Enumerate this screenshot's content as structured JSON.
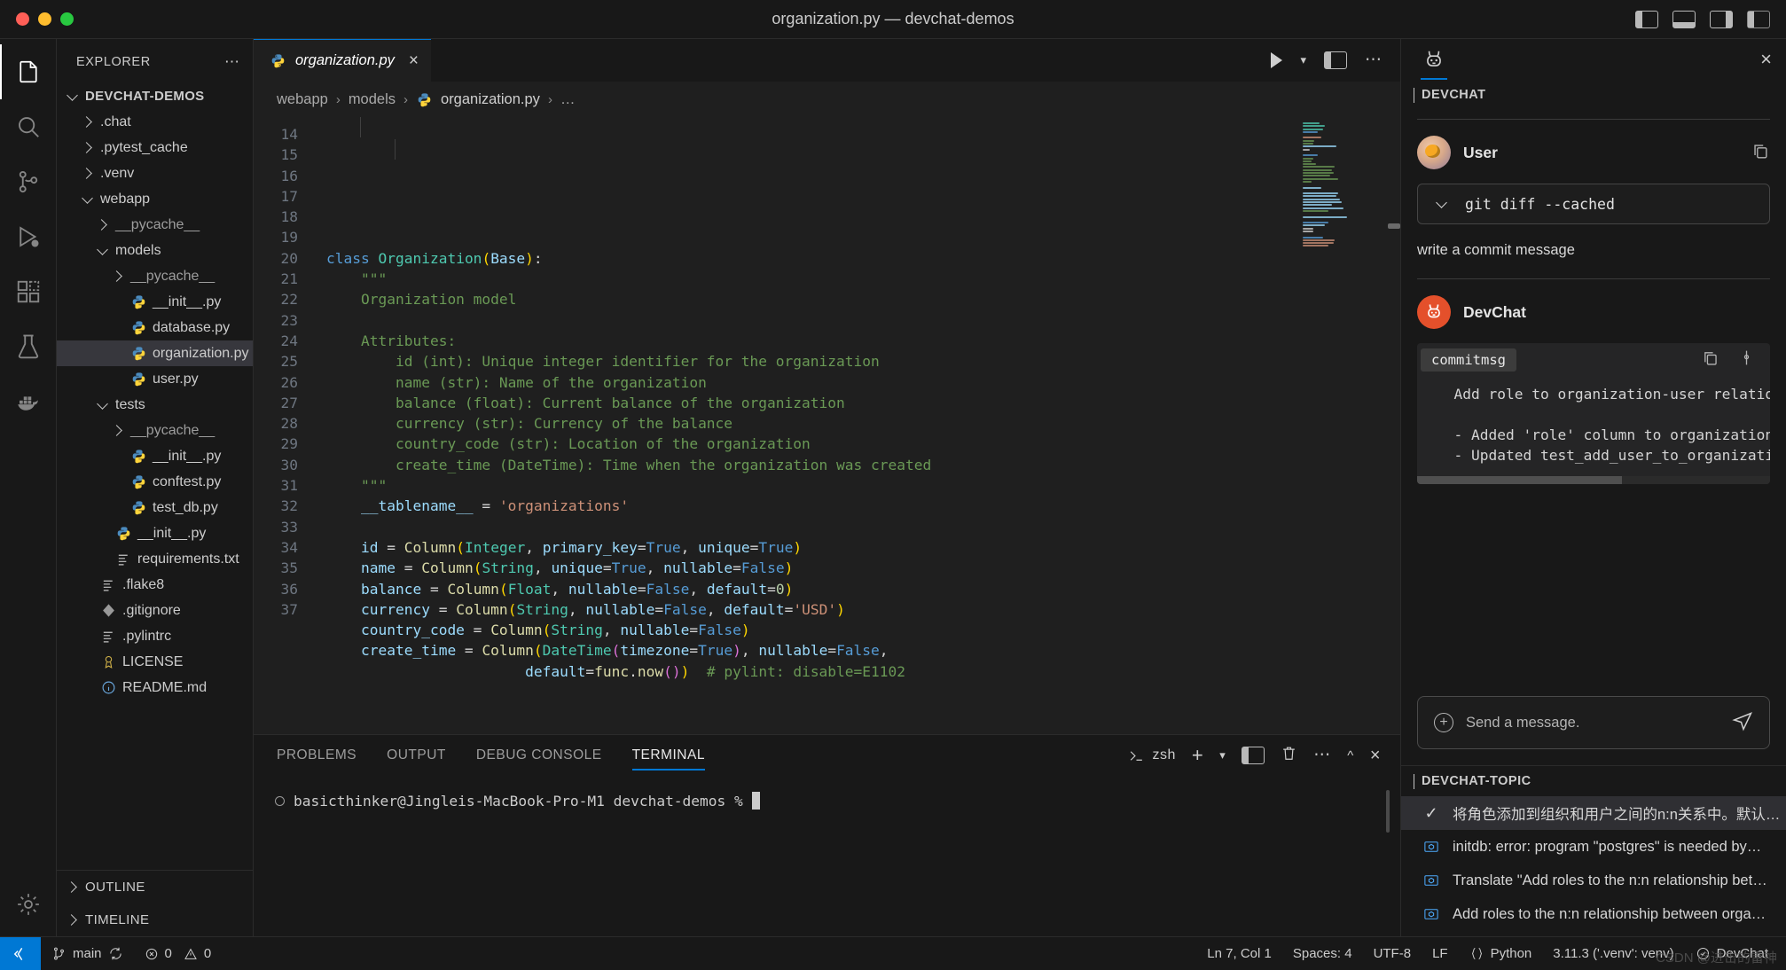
{
  "window": {
    "title": "organization.py — devchat-demos",
    "traffic_lights": [
      "close",
      "minimize",
      "zoom"
    ],
    "right_icons": [
      "panel-left-icon",
      "panel-bottom-icon",
      "panel-right-icon",
      "layout-icon",
      "more-icon"
    ]
  },
  "activitybar": {
    "items": [
      {
        "name": "explorer",
        "icon": "files-icon",
        "active": true
      },
      {
        "name": "search",
        "icon": "search-icon",
        "active": false
      },
      {
        "name": "source-control",
        "icon": "source-control-icon",
        "active": false
      },
      {
        "name": "run-and-debug",
        "icon": "debug-icon",
        "active": false
      },
      {
        "name": "extensions",
        "icon": "extensions-icon",
        "active": false
      },
      {
        "name": "testing",
        "icon": "beaker-icon",
        "active": false
      },
      {
        "name": "docker",
        "icon": "docker-icon",
        "active": false
      }
    ],
    "bottom": [
      {
        "name": "manage",
        "icon": "gear-icon"
      }
    ]
  },
  "explorer": {
    "title": "EXPLORER",
    "more_label": "...",
    "tree": [
      {
        "label": "DEVCHAT-DEMOS",
        "depth": 0,
        "type": "root",
        "twisty": "down"
      },
      {
        "label": ".chat",
        "depth": 1,
        "type": "folder",
        "twisty": "right"
      },
      {
        "label": ".pytest_cache",
        "depth": 1,
        "type": "folder",
        "twisty": "right"
      },
      {
        "label": ".venv",
        "depth": 1,
        "type": "folder",
        "twisty": "right"
      },
      {
        "label": "webapp",
        "depth": 1,
        "type": "folder",
        "twisty": "down"
      },
      {
        "label": "__pycache__",
        "depth": 2,
        "type": "folder",
        "twisty": "right",
        "dim": true
      },
      {
        "label": "models",
        "depth": 2,
        "type": "folder",
        "twisty": "down"
      },
      {
        "label": "__pycache__",
        "depth": 3,
        "type": "folder",
        "twisty": "right",
        "dim": true
      },
      {
        "label": "__init__.py",
        "depth": 3,
        "type": "python"
      },
      {
        "label": "database.py",
        "depth": 3,
        "type": "python"
      },
      {
        "label": "organization.py",
        "depth": 3,
        "type": "python",
        "selected": true
      },
      {
        "label": "user.py",
        "depth": 3,
        "type": "python"
      },
      {
        "label": "tests",
        "depth": 2,
        "type": "folder",
        "twisty": "down"
      },
      {
        "label": "__pycache__",
        "depth": 3,
        "type": "folder",
        "twisty": "right",
        "dim": true
      },
      {
        "label": "__init__.py",
        "depth": 3,
        "type": "python"
      },
      {
        "label": "conftest.py",
        "depth": 3,
        "type": "python"
      },
      {
        "label": "test_db.py",
        "depth": 3,
        "type": "python"
      },
      {
        "label": "__init__.py",
        "depth": 2,
        "type": "python"
      },
      {
        "label": "requirements.txt",
        "depth": 2,
        "type": "text"
      },
      {
        "label": ".flake8",
        "depth": 1,
        "type": "text"
      },
      {
        "label": ".gitignore",
        "depth": 1,
        "type": "git"
      },
      {
        "label": ".pylintrc",
        "depth": 1,
        "type": "text"
      },
      {
        "label": "LICENSE",
        "depth": 1,
        "type": "license"
      },
      {
        "label": "README.md",
        "depth": 1,
        "type": "info"
      }
    ],
    "footer": [
      {
        "label": "OUTLINE",
        "twisty": "right"
      },
      {
        "label": "TIMELINE",
        "twisty": "right"
      }
    ]
  },
  "editor": {
    "tab": {
      "label": "organization.py",
      "icon": "python-icon",
      "close": "×"
    },
    "actions": [
      "run-python-file-icon",
      "chevron-down-icon",
      "split-editor-icon",
      "more-actions-icon"
    ],
    "breadcrumb": [
      "webapp",
      "models",
      "organization.py",
      "…"
    ],
    "lines": [
      {
        "n": "14",
        "tokens": []
      },
      {
        "n": "15",
        "tokens": []
      },
      {
        "n": "16",
        "tokens": [
          [
            "k",
            "class "
          ],
          [
            "cls",
            "Organization"
          ],
          [
            "pn",
            "("
          ],
          [
            "var",
            "Base"
          ],
          [
            "pn",
            ")"
          ],
          [
            "op",
            ":"
          ]
        ]
      },
      {
        "n": "17",
        "tokens": [
          [
            "cmt",
            "    \"\"\""
          ]
        ]
      },
      {
        "n": "18",
        "tokens": [
          [
            "cmt",
            "    Organization model"
          ]
        ]
      },
      {
        "n": "19",
        "tokens": []
      },
      {
        "n": "20",
        "tokens": [
          [
            "cmt",
            "    Attributes:"
          ]
        ]
      },
      {
        "n": "21",
        "tokens": [
          [
            "cmt",
            "        id (int): Unique integer identifier for the organization"
          ]
        ]
      },
      {
        "n": "22",
        "tokens": [
          [
            "cmt",
            "        name (str): Name of the organization"
          ]
        ]
      },
      {
        "n": "23",
        "tokens": [
          [
            "cmt",
            "        balance (float): Current balance of the organization"
          ]
        ]
      },
      {
        "n": "24",
        "tokens": [
          [
            "cmt",
            "        currency (str): Currency of the balance"
          ]
        ]
      },
      {
        "n": "25",
        "tokens": [
          [
            "cmt",
            "        country_code (str): Location of the organization"
          ]
        ]
      },
      {
        "n": "26",
        "tokens": [
          [
            "cmt",
            "        create_time (DateTime): Time when the organization was created"
          ]
        ]
      },
      {
        "n": "27",
        "tokens": [
          [
            "cmt",
            "    \"\"\""
          ]
        ]
      },
      {
        "n": "28",
        "tokens": [
          [
            "var",
            "    __tablename__"
          ],
          [
            "op",
            " = "
          ],
          [
            "str",
            "'organizations'"
          ]
        ]
      },
      {
        "n": "29",
        "tokens": []
      },
      {
        "n": "30",
        "tokens": [
          [
            "var",
            "    id"
          ],
          [
            "op",
            " = "
          ],
          [
            "fn",
            "Column"
          ],
          [
            "pn",
            "("
          ],
          [
            "cls",
            "Integer"
          ],
          [
            "op",
            ", "
          ],
          [
            "var",
            "primary_key"
          ],
          [
            "op",
            "="
          ],
          [
            "k",
            "True"
          ],
          [
            "op",
            ", "
          ],
          [
            "var",
            "unique"
          ],
          [
            "op",
            "="
          ],
          [
            "k",
            "True"
          ],
          [
            "pn",
            ")"
          ]
        ]
      },
      {
        "n": "31",
        "tokens": [
          [
            "var",
            "    name"
          ],
          [
            "op",
            " = "
          ],
          [
            "fn",
            "Column"
          ],
          [
            "pn",
            "("
          ],
          [
            "cls",
            "String"
          ],
          [
            "op",
            ", "
          ],
          [
            "var",
            "unique"
          ],
          [
            "op",
            "="
          ],
          [
            "k",
            "True"
          ],
          [
            "op",
            ", "
          ],
          [
            "var",
            "nullable"
          ],
          [
            "op",
            "="
          ],
          [
            "k",
            "False"
          ],
          [
            "pn",
            ")"
          ]
        ]
      },
      {
        "n": "32",
        "tokens": [
          [
            "var",
            "    balance"
          ],
          [
            "op",
            " = "
          ],
          [
            "fn",
            "Column"
          ],
          [
            "pn",
            "("
          ],
          [
            "cls",
            "Float"
          ],
          [
            "op",
            ", "
          ],
          [
            "var",
            "nullable"
          ],
          [
            "op",
            "="
          ],
          [
            "k",
            "False"
          ],
          [
            "op",
            ", "
          ],
          [
            "var",
            "default"
          ],
          [
            "op",
            "="
          ],
          [
            "num",
            "0"
          ],
          [
            "pn",
            ")"
          ]
        ]
      },
      {
        "n": "33",
        "tokens": [
          [
            "var",
            "    currency"
          ],
          [
            "op",
            " = "
          ],
          [
            "fn",
            "Column"
          ],
          [
            "pn",
            "("
          ],
          [
            "cls",
            "String"
          ],
          [
            "op",
            ", "
          ],
          [
            "var",
            "nullable"
          ],
          [
            "op",
            "="
          ],
          [
            "k",
            "False"
          ],
          [
            "op",
            ", "
          ],
          [
            "var",
            "default"
          ],
          [
            "op",
            "="
          ],
          [
            "str",
            "'USD'"
          ],
          [
            "pn",
            ")"
          ]
        ]
      },
      {
        "n": "34",
        "tokens": [
          [
            "var",
            "    country_code"
          ],
          [
            "op",
            " = "
          ],
          [
            "fn",
            "Column"
          ],
          [
            "pn",
            "("
          ],
          [
            "cls",
            "String"
          ],
          [
            "op",
            ", "
          ],
          [
            "var",
            "nullable"
          ],
          [
            "op",
            "="
          ],
          [
            "k",
            "False"
          ],
          [
            "pn",
            ")"
          ]
        ]
      },
      {
        "n": "35",
        "tokens": [
          [
            "var",
            "    create_time"
          ],
          [
            "op",
            " = "
          ],
          [
            "fn",
            "Column"
          ],
          [
            "pn",
            "("
          ],
          [
            "cls",
            "DateTime"
          ],
          [
            "pn2",
            "("
          ],
          [
            "var",
            "timezone"
          ],
          [
            "op",
            "="
          ],
          [
            "k",
            "True"
          ],
          [
            "pn2",
            ")"
          ],
          [
            "op",
            ", "
          ],
          [
            "var",
            "nullable"
          ],
          [
            "op",
            "="
          ],
          [
            "k",
            "False"
          ],
          [
            "op",
            ","
          ]
        ]
      },
      {
        "n": "36",
        "tokens": [
          [
            "op",
            "                       "
          ],
          [
            "var",
            "default"
          ],
          [
            "op",
            "="
          ],
          [
            "fn",
            "func"
          ],
          [
            "op",
            "."
          ],
          [
            "fn",
            "now"
          ],
          [
            "pn2",
            "()"
          ],
          [
            "pn",
            ")"
          ],
          [
            "cmt",
            "  # pylint: disable=E1102"
          ]
        ]
      },
      {
        "n": "37",
        "tokens": []
      }
    ]
  },
  "panel": {
    "tabs": [
      "PROBLEMS",
      "OUTPUT",
      "DEBUG CONSOLE",
      "TERMINAL"
    ],
    "active_tab": "TERMINAL",
    "shell_label": "zsh",
    "actions": [
      "new-terminal-icon",
      "chevron-down-icon",
      "split-terminal-icon",
      "kill-terminal-icon",
      "more-icon",
      "chevron-up-icon",
      "close-icon"
    ],
    "prompt": "basicthinker@Jingleis-MacBook-Pro-M1 devchat-demos %"
  },
  "devchat": {
    "tab_icon": "devchat-rabbit-icon",
    "close_label": "×",
    "section_title": "DEVCHAT",
    "user": {
      "name": "User",
      "context_label": "git diff --cached",
      "message": "write a commit message",
      "copy_icon": "copy-icon",
      "chevron": "chevron-down-icon"
    },
    "assistant": {
      "name": "DevChat",
      "code_lang": "commitmsg",
      "actions": [
        "copy-icon",
        "insert-icon"
      ],
      "code_lines": [
        "  Add role to organization-user relationshi",
        "",
        "  - Added 'role' column to organization_use",
        "  - Updated test_add_user_to_organization t"
      ]
    },
    "input": {
      "placeholder": "Send a message.",
      "plus_icon": "plus-icon",
      "send_icon": "send-icon"
    },
    "topics_title": "DEVCHAT-TOPIC",
    "topics": [
      {
        "label": "将角色添加到组织和用户之间的n:n关系中。默认…",
        "icon": "check-icon",
        "selected": true
      },
      {
        "label": "initdb: error: program \"postgres\" is needed by…",
        "icon": "topic-icon"
      },
      {
        "label": "Translate \"Add roles to the n:n relationship bet…",
        "icon": "topic-icon"
      },
      {
        "label": "Add roles to the n:n relationship between orga…",
        "icon": "topic-icon"
      }
    ]
  },
  "statusbar": {
    "remote_icon": "remote-window-icon",
    "branch": "main",
    "sync_icon": "sync-icon",
    "errors": "0",
    "warnings": "0",
    "cursor": "Ln 7, Col 1",
    "indent": "Spaces: 4",
    "encoding": "UTF-8",
    "eol": "LF",
    "language": "Python",
    "interpreter": "3.11.3 ('.venv': venv)",
    "devchat": "DevChat",
    "watermark": "CSDN @进击的雷神"
  },
  "colors": {
    "accent": "#0078d4",
    "devchat_orange": "#e4502b",
    "selection": "#37373d",
    "bg": "#1f1f1f",
    "chrome": "#181818"
  }
}
